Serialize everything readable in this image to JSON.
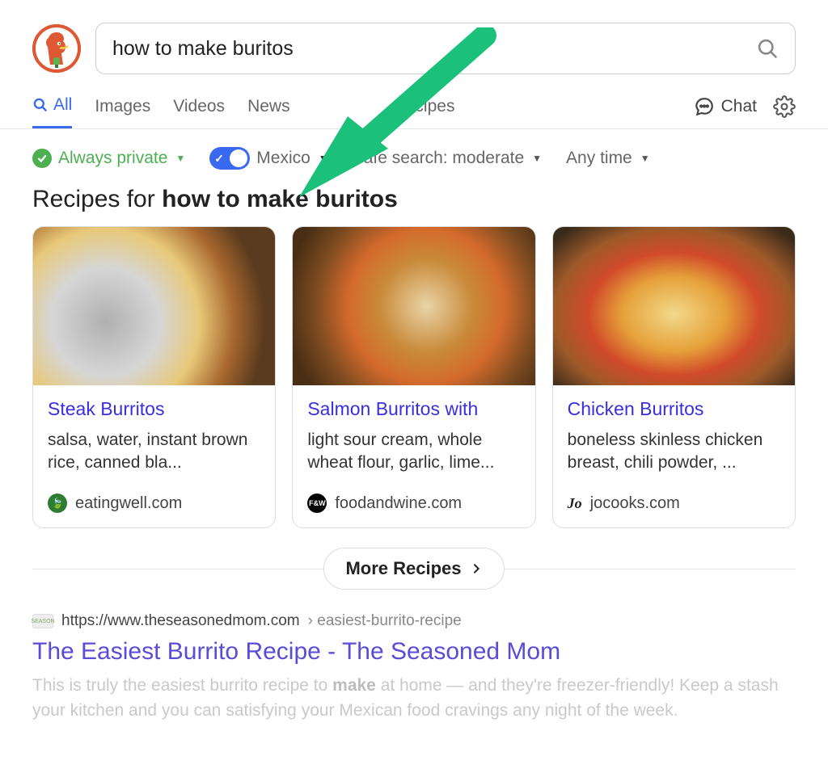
{
  "search": {
    "query": "how to make buritos"
  },
  "tabs": {
    "all": "All",
    "images": "Images",
    "videos": "Videos",
    "news": "News",
    "recipes": "Recipes",
    "chat": "Chat"
  },
  "filters": {
    "private": "Always private",
    "region": "Mexico",
    "safesearch": "Safe search: moderate",
    "anytime": "Any time"
  },
  "recipes_section": {
    "prefix": "Recipes for",
    "query_bold": "how to make buritos",
    "more_label": "More Recipes",
    "cards": [
      {
        "title": "Steak Burritos",
        "desc": "salsa, water, instant brown rice, canned bla...",
        "source": "eatingwell.com"
      },
      {
        "title": "Salmon Burritos with",
        "desc": "light sour cream, whole wheat flour, garlic, lime...",
        "source": "foodandwine.com"
      },
      {
        "title": "Chicken Burritos",
        "desc": "boneless skinless chicken breast, chili powder, ...",
        "source": "jocooks.com"
      }
    ]
  },
  "result": {
    "host": "https://www.theseasonedmom.com",
    "path": " › easiest-burrito-recipe",
    "title": "The Easiest Burrito Recipe - The Seasoned Mom",
    "snippet_pre": "This is truly the easiest burrito recipe to ",
    "snippet_bold": "make",
    "snippet_post": " at home — and they're freezer-friendly! Keep a stash your kitchen and you can satisfying your Mexican food cravings any night of the week."
  }
}
